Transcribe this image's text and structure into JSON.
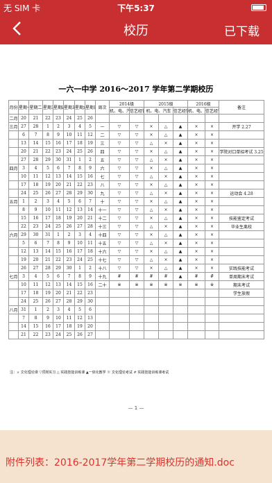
{
  "status": {
    "carrier": "无 SIM 卡",
    "time": "下午5:37"
  },
  "nav": {
    "title": "校历",
    "right": "已下载"
  },
  "doc": {
    "title": "一六一中学 2016～2017 学年第二学期校历",
    "headers": [
      "月份",
      "星期一",
      "星期二",
      "星期三",
      "星期四",
      "星期五",
      "星期六",
      "星期日",
      "周次",
      "2014级",
      "2015级",
      "2016级",
      "备注"
    ],
    "sub": [
      "机、电、汽车",
      "信艺经管",
      "机、电、汽车",
      "信艺经管",
      "机、电、汽车",
      "信艺经管"
    ],
    "rows": [
      [
        "二月",
        "20",
        "21",
        "22",
        "23",
        "24",
        "25",
        "26",
        "",
        "",
        "",
        "",
        "",
        "",
        "",
        "",
        ""
      ],
      [
        "三月",
        "27",
        "28",
        "1",
        "2",
        "3",
        "4",
        "5",
        "一",
        "▽",
        "▽",
        "×",
        "△",
        "▲",
        "×",
        "×",
        "开学 2.27"
      ],
      [
        "",
        "6",
        "7",
        "8",
        "9",
        "10",
        "11",
        "12",
        "二",
        "▽",
        "▽",
        "×",
        "△",
        "▲",
        "×",
        "×",
        ""
      ],
      [
        "",
        "13",
        "14",
        "15",
        "16",
        "17",
        "18",
        "19",
        "三",
        "▽",
        "▽",
        "△",
        "×",
        "▲",
        "×",
        "×",
        ""
      ],
      [
        "",
        "20",
        "21",
        "22",
        "23",
        "24",
        "25",
        "26",
        "四",
        "▽",
        "▽",
        "×",
        "△",
        "▲",
        "×",
        "×",
        "学院对口单招考试 3.25"
      ],
      [
        "",
        "27",
        "28",
        "29",
        "30",
        "31",
        "1",
        "2",
        "五",
        "▽",
        "▽",
        "△",
        "×",
        "▲",
        "×",
        "×",
        ""
      ],
      [
        "四月",
        "3",
        "4",
        "5",
        "6",
        "7",
        "8",
        "9",
        "六",
        "▽",
        "▽",
        "×",
        "△",
        "▲",
        "×",
        "×",
        ""
      ],
      [
        "",
        "10",
        "11",
        "12",
        "13",
        "14",
        "15",
        "16",
        "七",
        "▽",
        "▽",
        "△",
        "×",
        "▲",
        "×",
        "×",
        ""
      ],
      [
        "",
        "17",
        "18",
        "19",
        "20",
        "21",
        "22",
        "23",
        "八",
        "▽",
        "▽",
        "×",
        "△",
        "▲",
        "×",
        "×",
        ""
      ],
      [
        "",
        "24",
        "25",
        "26",
        "27",
        "28",
        "29",
        "30",
        "九",
        "▽",
        "▽",
        "△",
        "×",
        "▲",
        "×",
        "×",
        "运动会 4.28"
      ],
      [
        "五月",
        "1",
        "2",
        "3",
        "4",
        "5",
        "6",
        "7",
        "十",
        "▽",
        "▽",
        "×",
        "△",
        "▲",
        "×",
        "×",
        ""
      ],
      [
        "",
        "8",
        "9",
        "10",
        "11",
        "12",
        "13",
        "14",
        "十一",
        "▽",
        "▽",
        "△",
        "×",
        "▲",
        "×",
        "×",
        ""
      ],
      [
        "",
        "15",
        "16",
        "17",
        "18",
        "19",
        "20",
        "21",
        "十二",
        "▽",
        "▽",
        "×",
        "△",
        "▲",
        "×",
        "×",
        "技能鉴定考试"
      ],
      [
        "",
        "22",
        "23",
        "24",
        "25",
        "26",
        "27",
        "28",
        "十三",
        "▽",
        "▽",
        "△",
        "×",
        "▲",
        "×",
        "×",
        "毕业生离校"
      ],
      [
        "六月",
        "29",
        "30",
        "31",
        "1",
        "2",
        "3",
        "4",
        "十四",
        "▽",
        "▽",
        "×",
        "△",
        "▲",
        "×",
        "×",
        ""
      ],
      [
        "",
        "5",
        "6",
        "7",
        "8",
        "9",
        "10",
        "11",
        "十五",
        "▽",
        "▽",
        "△",
        "×",
        "▲",
        "×",
        "×",
        ""
      ],
      [
        "",
        "12",
        "13",
        "14",
        "15",
        "16",
        "17",
        "18",
        "十六",
        "▽",
        "▽",
        "×",
        "△",
        "▲",
        "×",
        "×",
        ""
      ],
      [
        "",
        "19",
        "20",
        "21",
        "22",
        "23",
        "24",
        "25",
        "十七",
        "▽",
        "▽",
        "△",
        "×",
        "▲",
        "×",
        "×",
        ""
      ],
      [
        "",
        "26",
        "27",
        "28",
        "29",
        "30",
        "1",
        "2",
        "十八",
        "▽",
        "▽",
        "×",
        "△",
        "▲",
        "×",
        "×",
        "实践技能考试"
      ],
      [
        "七月",
        "3",
        "4",
        "5",
        "6",
        "7",
        "8",
        "9",
        "十九",
        "#",
        "#",
        "#",
        "#",
        "▲",
        "#",
        "#",
        "单周期末考试"
      ],
      [
        "",
        "10",
        "11",
        "12",
        "13",
        "14",
        "15",
        "16",
        "二十",
        "※",
        "※",
        "※",
        "※",
        "※",
        "※",
        "※",
        "期末考试"
      ],
      [
        "",
        "17",
        "18",
        "19",
        "20",
        "21",
        "22",
        "23",
        "",
        "",
        "",
        "",
        "",
        "",
        "",
        "",
        "学生放假"
      ],
      [
        "",
        "24",
        "25",
        "26",
        "27",
        "28",
        "29",
        "30",
        "",
        "",
        "",
        "",
        "",
        "",
        "",
        "",
        ""
      ],
      [
        "八月",
        "31",
        "1",
        "2",
        "3",
        "4",
        "5",
        "6",
        "",
        "",
        "",
        "",
        "",
        "",
        "",
        "",
        ""
      ],
      [
        "",
        "7",
        "8",
        "9",
        "10",
        "11",
        "12",
        "13",
        "",
        "",
        "",
        "",
        "",
        "",
        "",
        "",
        ""
      ],
      [
        "",
        "14",
        "15",
        "16",
        "17",
        "18",
        "19",
        "20",
        "",
        "",
        "",
        "",
        "",
        "",
        "",
        "",
        ""
      ],
      [
        "",
        "21",
        "22",
        "23",
        "24",
        "25",
        "26",
        "27",
        "",
        "",
        "",
        "",
        "",
        "",
        "",
        "",
        ""
      ]
    ],
    "legend": "注：× 文化理论课  ▽顶岗实习  △ 实践技能训练课  ▲一体化教学  ※ 文化理论考试  # 实践技能训练课考试",
    "page": "— 1 —"
  },
  "footer": {
    "text": "附件列表：2016-2017学年第二学期校历的通知.doc"
  }
}
